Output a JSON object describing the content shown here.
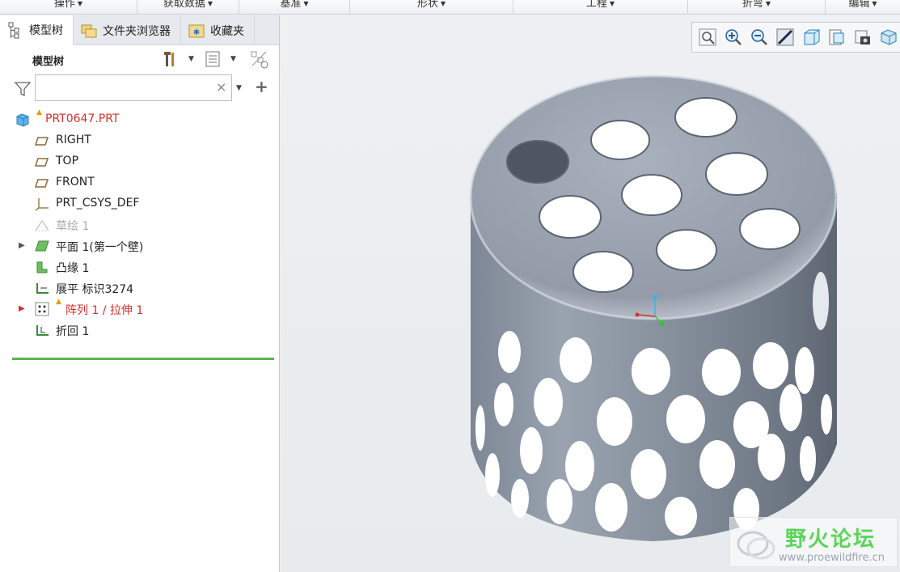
{
  "ribbon": {
    "groups": [
      {
        "label": "操作"
      },
      {
        "label": "获取数据"
      },
      {
        "label": "基准"
      },
      {
        "label": "形状"
      },
      {
        "label": "工程"
      },
      {
        "label": "折弯"
      },
      {
        "label": "编辑"
      }
    ]
  },
  "panel": {
    "tabs": [
      {
        "label": "模型树",
        "icon": "model-tree-icon"
      },
      {
        "label": "文件夹浏览器",
        "icon": "folder-browser-icon"
      },
      {
        "label": "收藏夹",
        "icon": "favorites-icon"
      }
    ],
    "tree_title": "模型树",
    "search": {
      "value": "",
      "placeholder": ""
    },
    "clear_glyph": "×",
    "add_glyph": "+"
  },
  "tree": {
    "root": {
      "label": "PRT0647.PRT",
      "icon": "part-icon",
      "warning": true
    },
    "items": [
      {
        "label": "RIGHT",
        "icon": "datum-plane-icon",
        "state": "normal"
      },
      {
        "label": "TOP",
        "icon": "datum-plane-icon",
        "state": "normal"
      },
      {
        "label": "FRONT",
        "icon": "datum-plane-icon",
        "state": "normal"
      },
      {
        "label": "PRT_CSYS_DEF",
        "icon": "csys-icon",
        "state": "normal"
      },
      {
        "label": "草绘 1",
        "icon": "sketch-icon",
        "state": "suppressed"
      },
      {
        "label": "平面 1(第一个壁)",
        "icon": "planar-wall-icon",
        "state": "normal",
        "expandable": true
      },
      {
        "label": "凸缘 1",
        "icon": "flange-icon",
        "state": "normal"
      },
      {
        "label": "展平 标识3274",
        "icon": "unbend-icon",
        "state": "normal"
      },
      {
        "label": "阵列 1 / 拉伸 1",
        "icon": "pattern-icon",
        "state": "error",
        "expandable": true,
        "warning": true
      },
      {
        "label": "折回 1",
        "icon": "bend-back-icon",
        "state": "normal"
      }
    ]
  },
  "view_toolbar": [
    {
      "name": "refit-icon"
    },
    {
      "name": "zoom-in-icon"
    },
    {
      "name": "zoom-out-icon"
    },
    {
      "name": "repaint-icon"
    },
    {
      "name": "display-style-icon"
    },
    {
      "name": "saved-views-icon"
    },
    {
      "name": "view-manager-icon"
    },
    {
      "name": "datum-display-icon"
    }
  ],
  "watermark": {
    "title": "野火论坛",
    "url": "www.proewildfire.cn"
  },
  "colors": {
    "accent_green": "#55b64a",
    "error_red": "#d43030",
    "model_gray": "#8a94a2"
  }
}
